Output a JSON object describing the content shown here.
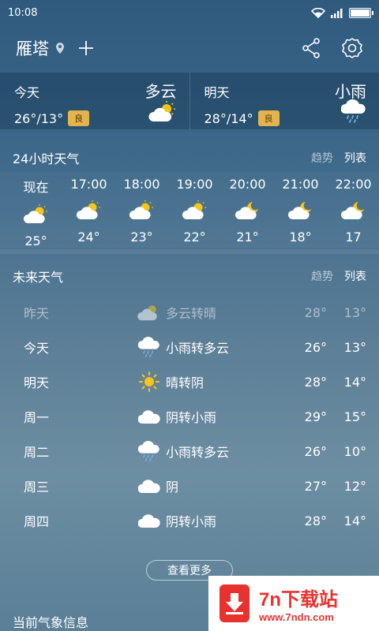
{
  "status": {
    "time": "10:08"
  },
  "header": {
    "city": "雁塔"
  },
  "today": {
    "label": "今天",
    "temp": "26°/13°",
    "aqi": "良",
    "condition": "多云"
  },
  "tomorrow": {
    "label": "明天",
    "temp": "28°/14°",
    "aqi": "良",
    "condition": "小雨"
  },
  "hourly_section": {
    "title": "24小时天气",
    "tab_trend": "趋势",
    "tab_list": "列表"
  },
  "hourly": [
    {
      "time": "现在",
      "temp": "25°",
      "icon": "partly-cloudy-icon"
    },
    {
      "time": "17:00",
      "temp": "24°",
      "icon": "partly-cloudy-icon"
    },
    {
      "time": "18:00",
      "temp": "23°",
      "icon": "partly-cloudy-icon"
    },
    {
      "time": "19:00",
      "temp": "22°",
      "icon": "partly-cloudy-icon"
    },
    {
      "time": "20:00",
      "temp": "21°",
      "icon": "partly-cloudy-night-icon"
    },
    {
      "time": "21:00",
      "temp": "18°",
      "icon": "partly-cloudy-night-icon"
    },
    {
      "time": "22:00",
      "temp": "17",
      "icon": "partly-cloudy-night-icon"
    }
  ],
  "forecast_section": {
    "title": "未来天气",
    "tab_trend": "趋势",
    "tab_list": "列表"
  },
  "forecast": [
    {
      "day": "昨天",
      "condition": "多云转晴",
      "high": "28°",
      "low": "13°",
      "icon": "partly-cloudy-icon"
    },
    {
      "day": "今天",
      "condition": "小雨转多云",
      "high": "26°",
      "low": "13°",
      "icon": "light-rain-icon"
    },
    {
      "day": "明天",
      "condition": "晴转阴",
      "high": "28°",
      "low": "14°",
      "icon": "sunny-icon"
    },
    {
      "day": "周一",
      "condition": "阴转小雨",
      "high": "29°",
      "low": "15°",
      "icon": "cloudy-icon"
    },
    {
      "day": "周二",
      "condition": "小雨转多云",
      "high": "26°",
      "low": "10°",
      "icon": "light-rain-icon"
    },
    {
      "day": "周三",
      "condition": "阴",
      "high": "27°",
      "low": "12°",
      "icon": "cloudy-icon"
    },
    {
      "day": "周四",
      "condition": "阴转小雨",
      "high": "28°",
      "low": "14°",
      "icon": "cloudy-icon"
    }
  ],
  "more_button": "查看更多",
  "bottom_section": {
    "title": "当前气象信息"
  },
  "watermark": {
    "brand": "7n下载站",
    "url": "www.7ndn.com"
  }
}
